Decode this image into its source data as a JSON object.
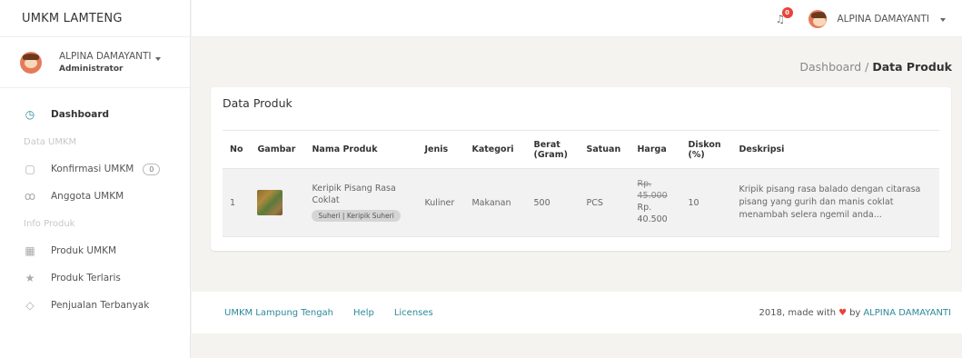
{
  "app": {
    "brand": "UMKM LAMTENG"
  },
  "user": {
    "name": "ALPINA DAMAYANTI",
    "role": "Administrator"
  },
  "sidebar": {
    "dashboard": "Dashboard",
    "section_umkm": "Data UMKM",
    "konfirmasi": "Konfirmasi UMKM",
    "konfirmasi_count": "0",
    "anggota": "Anggota UMKM",
    "section_produk": "Info Produk",
    "produk": "Produk UMKM",
    "terlaris": "Produk Terlaris",
    "penjualan": "Penjualan Terbanyak"
  },
  "topbar": {
    "notif_count": "0",
    "user_name": "ALPINA DAMAYANTI"
  },
  "breadcrumb": {
    "parent": "Dashboard",
    "sep": " / ",
    "current": "Data Produk"
  },
  "card": {
    "title": "Data Produk"
  },
  "table": {
    "headers": {
      "no": "No",
      "gambar": "Gambar",
      "nama": "Nama Produk",
      "jenis": "Jenis",
      "kategori": "Kategori",
      "berat": "Berat (Gram)",
      "satuan": "Satuan",
      "harga": "Harga",
      "diskon": "Diskon (%)",
      "deskripsi": "Deskripsi"
    },
    "rows": [
      {
        "no": "1",
        "nama": "Keripik Pisang Rasa Coklat",
        "toko": "Suheri | Keripik Suheri",
        "jenis": "Kuliner",
        "kategori": "Makanan",
        "berat": "500",
        "satuan": "PCS",
        "harga_lama": "Rp. 45.000",
        "harga_baru": "Rp. 40.500",
        "diskon": "10",
        "deskripsi": "Kripik pisang rasa balado dengan citarasa pisang yang gurih dan manis coklat menambah selera ngemil anda..."
      }
    ]
  },
  "footer": {
    "link1": "UMKM Lampung Tengah",
    "link2": "Help",
    "link3": "Licenses",
    "made_prefix": "2018, made with",
    "made_by": "by",
    "author": "ALPINA DAMAYANTI"
  },
  "colors": {
    "accent": "#2c8a9a",
    "danger": "#e8433b"
  }
}
